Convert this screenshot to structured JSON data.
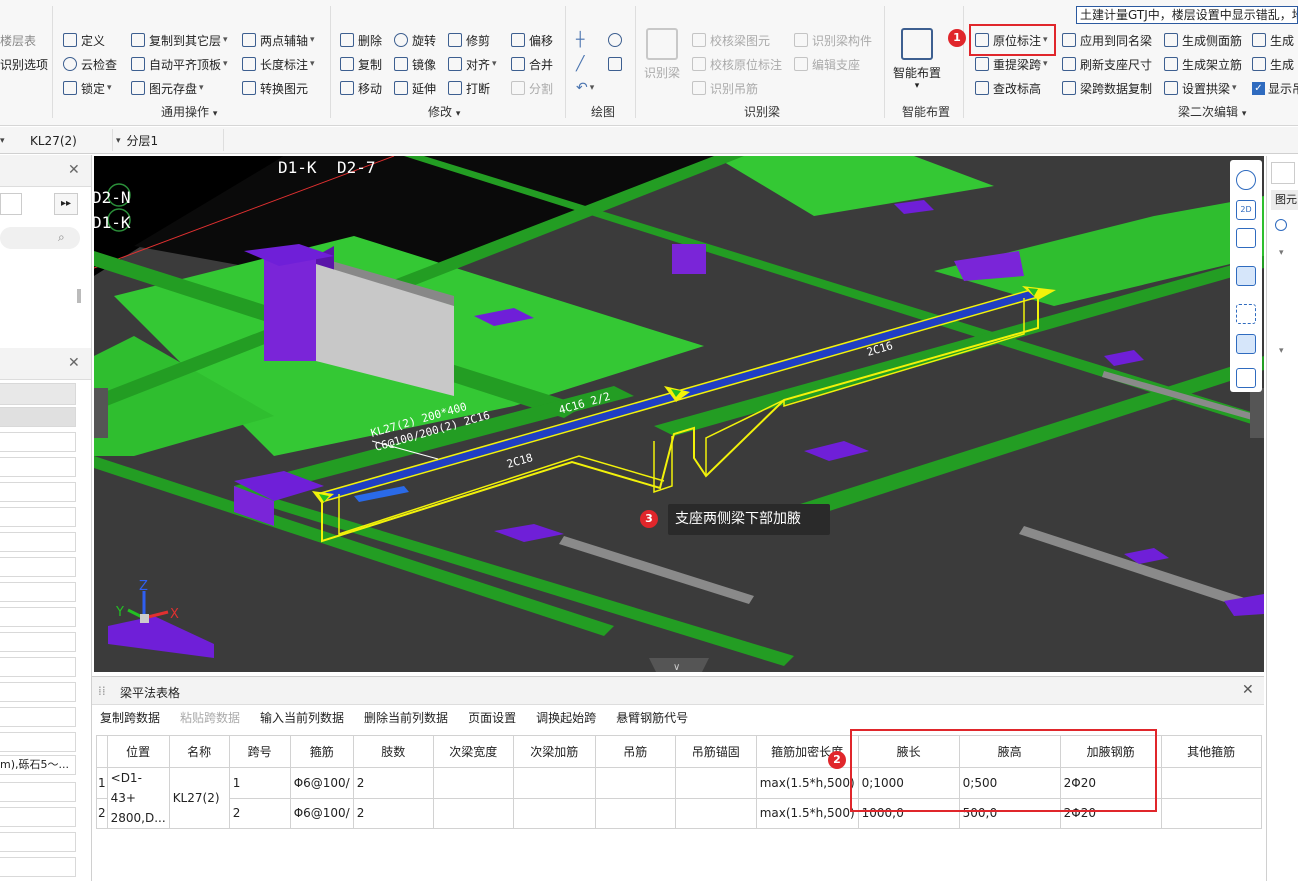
{
  "ribbon": {
    "banner": "土建计量GTJ中，楼层设置中显示错乱，地",
    "left_partial": [
      "楼层表",
      "识别选项"
    ],
    "general_ops": {
      "label": "通用操作",
      "items": [
        "定义",
        "云检查",
        "锁定",
        "复制到其它层",
        "自动平齐顶板",
        "图元存盘",
        "两点辅轴",
        "长度标注",
        "转换图元"
      ]
    },
    "modify": {
      "label": "修改",
      "items": [
        "删除",
        "复制",
        "移动",
        "旋转",
        "镜像",
        "延伸",
        "修剪",
        "对齐",
        "打断",
        "偏移",
        "合并",
        "分割"
      ]
    },
    "draw": {
      "label": "绘图"
    },
    "identify_beam": {
      "label": "识别梁",
      "big": "识别梁",
      "items": [
        "校核梁图元",
        "校核原位标注",
        "识别吊筋",
        "识别梁构件",
        "编辑支座"
      ]
    },
    "smart_layout": {
      "label": "智能布置",
      "big": "智能布置"
    },
    "beam_edit": {
      "label": "梁二次编辑",
      "items": [
        "原位标注",
        "重提梁跨",
        "查改标高",
        "应用到同名梁",
        "刷新支座尺寸",
        "梁跨数据复制",
        "生成侧面筋",
        "生成架立筋",
        "设置拱梁",
        "生成",
        "生成",
        "显示吊"
      ]
    }
  },
  "selectors": {
    "component": "KL27(2)",
    "layer": "分层1"
  },
  "viewport": {
    "axis_labels": [
      "D1-K",
      "D2-7",
      "D2-N",
      "D1-K"
    ],
    "beam_annotations": [
      "KL27(2) 200*400",
      "C6@100/200(2) 2C16",
      "4C16 2/2",
      "2C18",
      "2C16"
    ],
    "callout": "支座两侧梁下部加腋",
    "axes": [
      "X",
      "Y",
      "Z"
    ]
  },
  "callouts": {
    "c1": "1",
    "c2": "2",
    "c3": "3"
  },
  "left_panel": {
    "partial_text": "m),砾石5～..."
  },
  "table": {
    "title": "梁平法表格",
    "toolbar": [
      "复制跨数据",
      "粘贴跨数据",
      "输入当前列数据",
      "删除当前列数据",
      "页面设置",
      "调换起始跨",
      "悬臂钢筋代号"
    ],
    "headers": [
      "位置",
      "名称",
      "跨号",
      "箍筋",
      "肢数",
      "次梁宽度",
      "次梁加筋",
      "吊筋",
      "吊筋锚固",
      "箍筋加密长度",
      "腋长",
      "腋高",
      "加腋钢筋",
      "其他箍筋"
    ],
    "rows": [
      {
        "idx": "1",
        "pos": "<D1-43+",
        "name": "KL27(2)",
        "span": "1",
        "stirrup": "Φ6@100/",
        "legs": "2",
        "dense": "max(1.5*h,500)",
        "haunch_len": "0;1000",
        "haunch_h": "0;500",
        "haunch_bar": "2Φ20"
      },
      {
        "idx": "2",
        "pos": "2800,D...",
        "name": "",
        "span": "2",
        "stirrup": "Φ6@100/",
        "legs": "2",
        "dense": "max(1.5*h,500)",
        "haunch_len": "1000;0",
        "haunch_h": "500;0",
        "haunch_bar": "2Φ20"
      }
    ]
  },
  "colors": {
    "accent_red": "#e0262b",
    "slab_green": "#2bd32b",
    "beam_yellow": "#f2f20a",
    "column_purple": "#6f1fd8",
    "viewport_bg": "#3b3b3b"
  }
}
